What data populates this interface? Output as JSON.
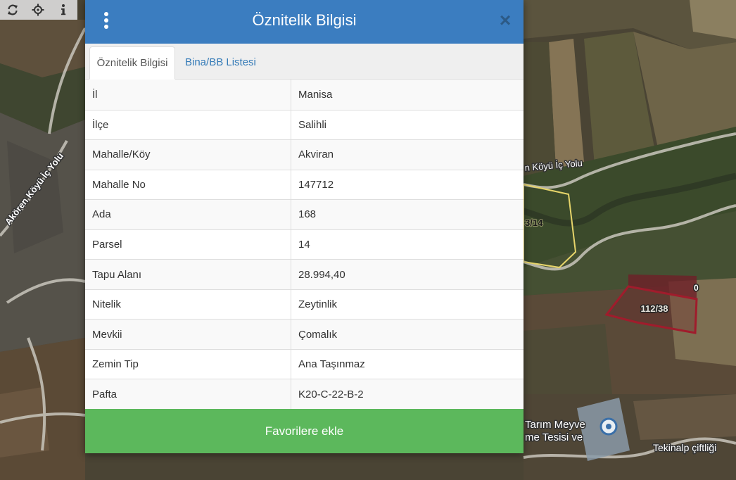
{
  "map": {
    "toolbar": {
      "refresh_icon": "refresh-icon",
      "locate_icon": "crosshair-icon",
      "info_icon": "info-icon"
    },
    "labels": {
      "road_west": "Akören Köyü İç Yolu",
      "road_east": "n Köyü İç Yolu",
      "parcel_a": "3/14",
      "parcel_b": "112/38",
      "parcel_c": "0",
      "facility_line1": "Tarım Meyve",
      "facility_line2": "me Tesisi ve",
      "farm": "Tekinalp çiftliği"
    },
    "colors": {
      "parcel_selected": "#a01c2c",
      "parcel_other": "#e6d46a",
      "road": "#c9c6bc"
    }
  },
  "panel": {
    "title": "Öznitelik Bilgisi",
    "menu_icon": "kebab-menu-icon",
    "close_icon": "close-icon",
    "close_glyph": "×",
    "tabs": [
      {
        "label": "Öznitelik Bilgisi",
        "active": true
      },
      {
        "label": "Bina/BB Listesi",
        "active": false
      }
    ],
    "rows": [
      {
        "label": "İl",
        "value": "Manisa"
      },
      {
        "label": "İlçe",
        "value": "Salihli"
      },
      {
        "label": "Mahalle/Köy",
        "value": "Akviran"
      },
      {
        "label": "Mahalle No",
        "value": "147712"
      },
      {
        "label": "Ada",
        "value": "168"
      },
      {
        "label": "Parsel",
        "value": "14"
      },
      {
        "label": "Tapu Alanı",
        "value": "28.994,40"
      },
      {
        "label": "Nitelik",
        "value": "Zeytinlik"
      },
      {
        "label": "Mevkii",
        "value": "Çomalık"
      },
      {
        "label": "Zemin Tip",
        "value": "Ana Taşınmaz"
      },
      {
        "label": "Pafta",
        "value": "K20-C-22-B-2"
      }
    ],
    "favorite_button": "Favorilere ekle",
    "colors": {
      "header": "#3b7dc0",
      "tab_link": "#337ab7",
      "button": "#5cb85c"
    }
  }
}
